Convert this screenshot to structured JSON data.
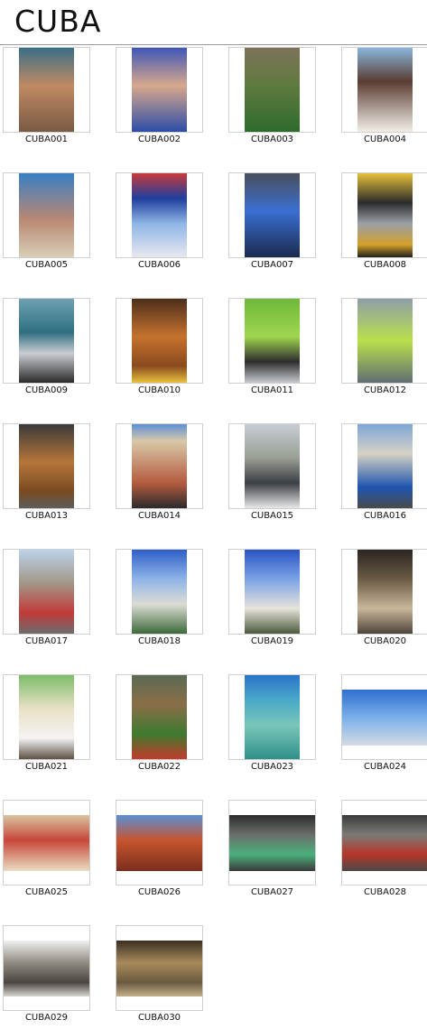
{
  "page": {
    "title": "CUBA"
  },
  "gallery": {
    "items": [
      {
        "caption": "CUBA001",
        "orientation": "portrait",
        "bg": "linear-gradient(180deg,#3b6e86 0%,#c08a64 45%,#7a5a44 100%)"
      },
      {
        "caption": "CUBA002",
        "orientation": "portrait",
        "bg": "linear-gradient(180deg,#3f56b8 0%,#d7a88c 45%,#2c4ca8 100%)"
      },
      {
        "caption": "CUBA003",
        "orientation": "portrait",
        "bg": "linear-gradient(180deg,#7d7259 0%,#5f7a3e 45%,#2f6a2d 100%)"
      },
      {
        "caption": "CUBA004",
        "orientation": "portrait",
        "bg": "linear-gradient(180deg,#8ab6dc 0%,#5a3d32 40%,#f2efe8 100%)"
      },
      {
        "caption": "CUBA005",
        "orientation": "portrait",
        "bg": "linear-gradient(180deg,#3a7fc4 0%,#b98872 55%,#d9cfb8 100%)"
      },
      {
        "caption": "CUBA006",
        "orientation": "portrait",
        "bg": "linear-gradient(180deg,#c83a3a 0%,#1f3e9e 30%,#8fb6e6 60%,#e8e8ef 100%)"
      },
      {
        "caption": "CUBA007",
        "orientation": "portrait",
        "bg": "linear-gradient(180deg,#4a4f5c 0%,#3a6fd1 45%,#1b2a4e 100%)"
      },
      {
        "caption": "CUBA008",
        "orientation": "portrait",
        "bg": "linear-gradient(180deg,#e6c13a 0%,#2b2b2b 35%,#9aa0a8 60%,#d5a12a 85%,#1f1f1f 100%)"
      },
      {
        "caption": "CUBA009",
        "orientation": "portrait",
        "bg": "linear-gradient(180deg,#6ea1b2 0%,#2f6f82 40%,#c9cdd2 65%,#2a2a2a 100%)"
      },
      {
        "caption": "CUBA010",
        "orientation": "portrait",
        "bg": "linear-gradient(180deg,#4d2f1a 0%,#c6722e 45%,#8a4a1e 80%,#e8c23b 100%)"
      },
      {
        "caption": "CUBA011",
        "orientation": "portrait",
        "bg": "linear-gradient(180deg,#6fb83a 0%,#9fd64f 45%,#2d2d2d 75%,#c5c9ce 100%)"
      },
      {
        "caption": "CUBA012",
        "orientation": "portrait",
        "bg": "linear-gradient(180deg,#8f9ea8 0%,#b9e04a 50%,#616d74 100%)"
      },
      {
        "caption": "CUBA013",
        "orientation": "portrait",
        "bg": "linear-gradient(180deg,#3a3a3a 0%,#b5763a 45%,#7a4a22 80%,#5d5d5d 100%)"
      },
      {
        "caption": "CUBA014",
        "orientation": "portrait",
        "bg": "linear-gradient(180deg,#5f8fd6 0%,#d8c8a8 20%,#b55b3f 70%,#2b2b2b 100%)"
      },
      {
        "caption": "CUBA015",
        "orientation": "portrait",
        "bg": "linear-gradient(180deg,#c7cdd4 0%,#9a9f95 40%,#3b3f43 70%,#e8e8e8 100%)"
      },
      {
        "caption": "CUBA016",
        "orientation": "portrait",
        "bg": "linear-gradient(180deg,#7fa6d8 0%,#d6d2c4 35%,#1f55b0 75%,#4b4b4b 100%)"
      },
      {
        "caption": "CUBA017",
        "orientation": "portrait",
        "bg": "linear-gradient(180deg,#bcd3ea 0%,#a19787 40%,#c23a3a 75%,#6d6d6d 100%)"
      },
      {
        "caption": "CUBA018",
        "orientation": "portrait",
        "bg": "linear-gradient(180deg,#2f5fc8 0%,#8fb4e8 35%,#dcdcd4 65%,#3c6a3a 100%)"
      },
      {
        "caption": "CUBA019",
        "orientation": "portrait",
        "bg": "linear-gradient(180deg,#2a55c2 0%,#7aa3e6 35%,#e6e3da 70%,#4c5a3d 100%)"
      },
      {
        "caption": "CUBA020",
        "orientation": "portrait",
        "bg": "linear-gradient(180deg,#2a2622 0%,#6b5a45 35%,#c9b79a 70%,#4e443a 100%)"
      },
      {
        "caption": "CUBA021",
        "orientation": "portrait",
        "bg": "linear-gradient(180deg,#7dbd6a 0%,#e9e0c6 40%,#f3f3f3 75%,#5d5144 100%)"
      },
      {
        "caption": "CUBA022",
        "orientation": "portrait",
        "bg": "linear-gradient(180deg,#5a6a52 0%,#8a6e48 35%,#3e7a2f 70%,#c23a2a 100%)"
      },
      {
        "caption": "CUBA023",
        "orientation": "portrait",
        "bg": "linear-gradient(180deg,#2a74c8 0%,#4aa9c9 30%,#79c6b8 60%,#2f8f8a 100%)"
      },
      {
        "caption": "CUBA024",
        "orientation": "landscape",
        "bg": "linear-gradient(180deg,#2f6fcf 0%,#7ab0ea 50%,#d4dbe4 100%)"
      },
      {
        "caption": "CUBA025",
        "orientation": "landscape",
        "bg": "linear-gradient(180deg,#d8c4a0 0%,#c8463a 45%,#e9dcc2 100%)"
      },
      {
        "caption": "CUBA026",
        "orientation": "landscape",
        "bg": "linear-gradient(180deg,#5c8fd6 0%,#c7552f 45%,#7a2e1c 100%)"
      },
      {
        "caption": "CUBA027",
        "orientation": "landscape",
        "bg": "linear-gradient(180deg,#2c2c2c 0%,#6b6f6b 35%,#4bb07c 70%,#3a3a3a 100%)"
      },
      {
        "caption": "CUBA028",
        "orientation": "landscape",
        "bg": "linear-gradient(180deg,#3a3a3a 0%,#7b7b76 35%,#b8352a 70%,#4a4a4a 100%)"
      },
      {
        "caption": "CUBA029",
        "orientation": "landscape",
        "bg": "linear-gradient(180deg,#f0f0f0 0%,#8f8a80 40%,#4a4540 75%,#d8d6d0 100%)"
      },
      {
        "caption": "CUBA030",
        "orientation": "landscape",
        "bg": "linear-gradient(180deg,#3a2f22 0%,#a88a5c 40%,#6b5a40 75%,#c2b08a 100%)"
      }
    ]
  }
}
